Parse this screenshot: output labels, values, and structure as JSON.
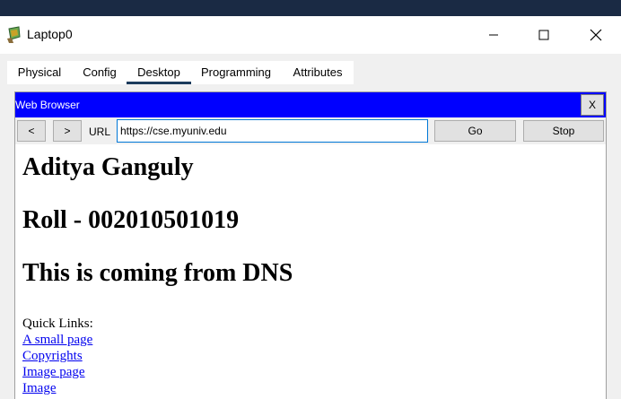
{
  "window": {
    "title": "Laptop0",
    "icon": "laptop-app-icon"
  },
  "tabs": [
    {
      "label": "Physical",
      "active": false
    },
    {
      "label": "Config",
      "active": false
    },
    {
      "label": "Desktop",
      "active": true
    },
    {
      "label": "Programming",
      "active": false
    },
    {
      "label": "Attributes",
      "active": false
    }
  ],
  "browser": {
    "title": "Web Browser",
    "close_label": "X",
    "back_label": "<",
    "forward_label": ">",
    "url_label": "URL",
    "url_value": "https://cse.myuniv.edu",
    "go_label": "Go",
    "stop_label": "Stop",
    "titlebar_color": "#0000ff"
  },
  "page": {
    "heading_name": "Aditya Ganguly",
    "heading_roll": "Roll - 002010501019",
    "heading_dns": "This is coming from DNS",
    "quick_links_label": "Quick Links:",
    "links": [
      "A small page",
      "Copyrights",
      "Image page",
      "Image"
    ],
    "link_color": "#0000ee"
  }
}
